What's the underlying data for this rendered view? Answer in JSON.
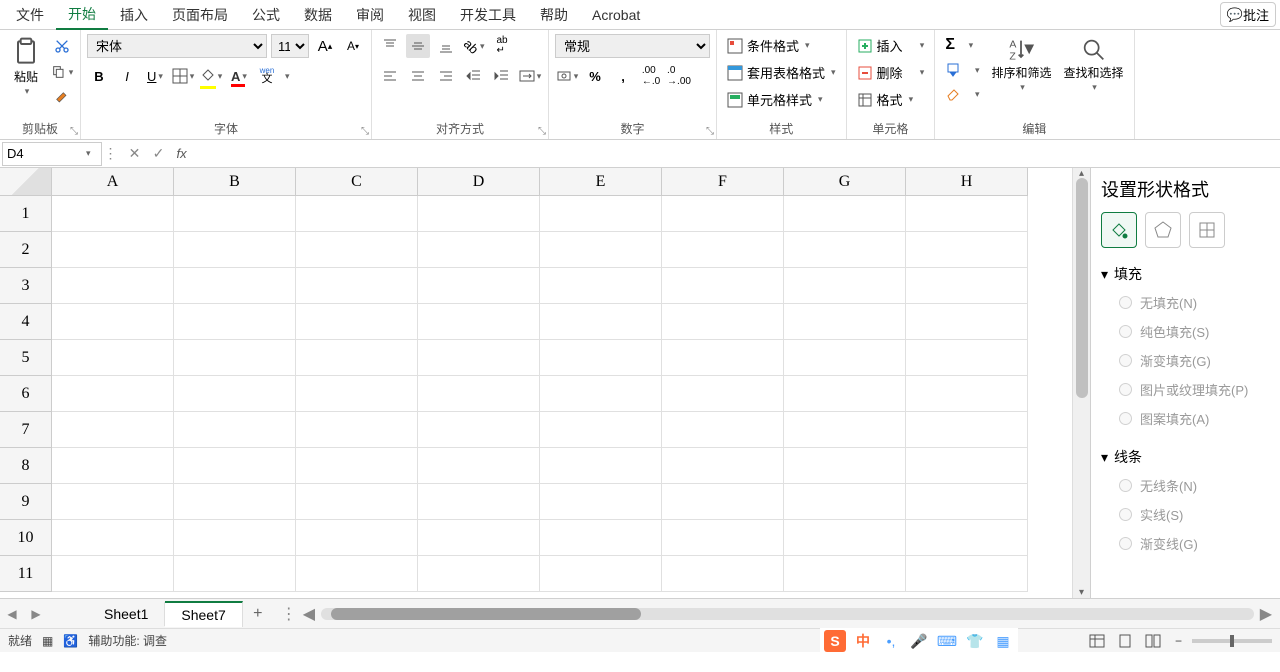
{
  "menu": {
    "items": [
      "文件",
      "开始",
      "插入",
      "页面布局",
      "公式",
      "数据",
      "审阅",
      "视图",
      "开发工具",
      "帮助",
      "Acrobat"
    ],
    "active_index": 1,
    "comment": "批注"
  },
  "clipboard": {
    "paste": "粘贴",
    "group_label": "剪贴板"
  },
  "font": {
    "name": "宋体",
    "size": "11",
    "ruby": "wen",
    "ruby2": "文",
    "group_label": "字体"
  },
  "alignment": {
    "group_label": "对齐方式"
  },
  "number": {
    "format": "常规",
    "group_label": "数字"
  },
  "styles": {
    "conditional": "条件格式",
    "table": "套用表格格式",
    "cell": "单元格样式",
    "group_label": "样式"
  },
  "cells": {
    "insert": "插入",
    "delete": "删除",
    "format": "格式",
    "group_label": "单元格"
  },
  "editing": {
    "sort": "排序和筛选",
    "find": "查找和选择",
    "group_label": "编辑"
  },
  "namebox": "D4",
  "formula": "",
  "columns": [
    "A",
    "B",
    "C",
    "D",
    "E",
    "F",
    "G",
    "H"
  ],
  "rows": [
    "1",
    "2",
    "3",
    "4",
    "5",
    "6",
    "7",
    "8",
    "9",
    "10",
    "11"
  ],
  "panel": {
    "title": "设置形状格式",
    "fill": {
      "label": "填充",
      "options": [
        "无填充(N)",
        "纯色填充(S)",
        "渐变填充(G)",
        "图片或纹理填充(P)",
        "图案填充(A)"
      ]
    },
    "line": {
      "label": "线条",
      "options": [
        "无线条(N)",
        "实线(S)",
        "渐变线(G)"
      ]
    }
  },
  "sheets": {
    "tabs": [
      "Sheet1",
      "Sheet7"
    ],
    "active_index": 1
  },
  "status": {
    "ready": "就绪",
    "accessibility": "辅助功能: 调查"
  },
  "ime": {
    "lang": "中"
  }
}
